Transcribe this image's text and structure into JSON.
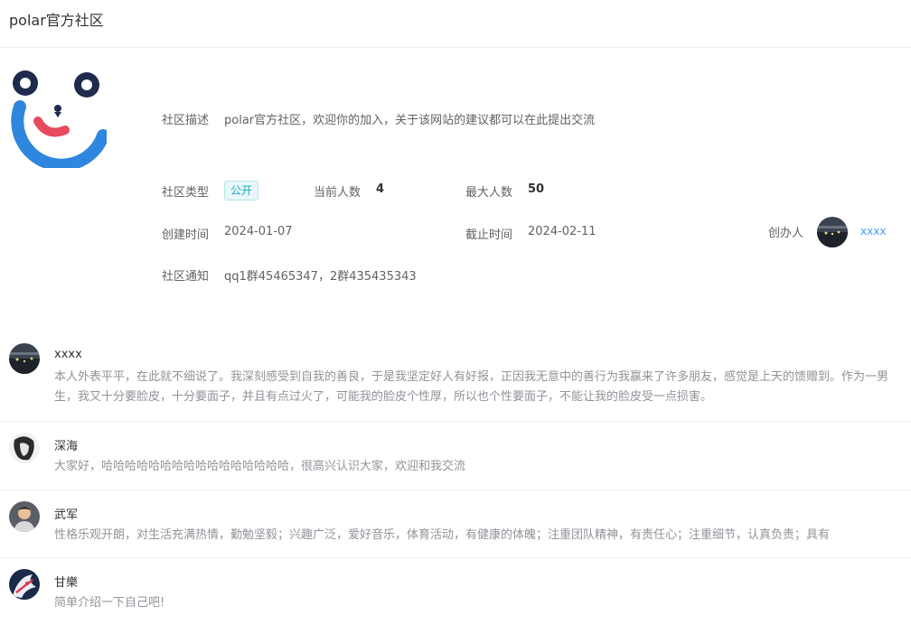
{
  "page": {
    "title": "polar官方社区"
  },
  "community": {
    "desc_label": "社区描述",
    "desc": "polar官方社区，欢迎你的加入，关于该网站的建议都可以在此提出交流",
    "type_label": "社区类型",
    "type_tag": "公开",
    "current_label": "当前人数",
    "current_count": "4",
    "max_label": "最大人数",
    "max_count": "50",
    "created_label": "创建时间",
    "created": "2024-01-07",
    "deadline_label": "截止时间",
    "deadline": "2024-02-11",
    "creator_label": "创办人",
    "creator_name": "xxxx",
    "notice_label": "社区通知",
    "notice": "qq1群45465347，2群435435343"
  },
  "members": [
    {
      "name": "xxxx",
      "intro": "本人外表平平，在此就不细说了。我深刻感受到自我的善良，于是我坚定好人有好报，正因我无意中的善行为我赢来了许多朋友，感觉是上天的馈赠到。作为一男生，我又十分要脸皮，十分要面子，并且有点过火了，可能我的脸皮个性厚，所以也个性要面子，不能让我的脸皮受一点损害。",
      "avatar": "night-landscape"
    },
    {
      "name": "深海",
      "intro": "大家好，哈哈哈哈哈哈哈哈哈哈哈哈哈哈哈哈，很高兴认识大家，欢迎和我交流",
      "avatar": "sketch-portrait"
    },
    {
      "name": "武军",
      "intro": "性格乐观开朗，对生活充满热情，勤勉坚毅；兴趣广泛，爱好音乐，体育活动，有健康的体魄；注重团队精神，有责任心；注重细节，认真负责；具有",
      "avatar": "cartoon-man"
    },
    {
      "name": "甘樂",
      "intro": "简单介绍一下自己吧!",
      "avatar": "anime-character"
    }
  ]
}
